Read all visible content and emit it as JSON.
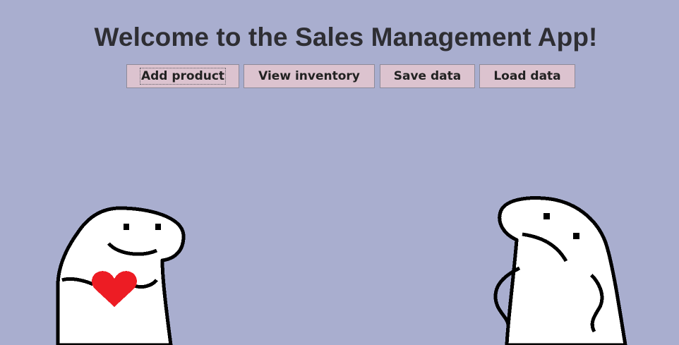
{
  "app": {
    "title": "Welcome to the Sales Management App!",
    "background": "#a9aecf"
  },
  "toolbar": {
    "buttons": [
      {
        "label": "Add product",
        "focused": true
      },
      {
        "label": "View inventory"
      },
      {
        "label": "Save data"
      },
      {
        "label": "Load data"
      }
    ],
    "button_color": "#dcc3cf"
  },
  "illustrations": {
    "left": {
      "icon": "flork-heart-character-icon",
      "accent": "#ed1c24"
    },
    "right": {
      "icon": "flork-sad-character-icon"
    }
  }
}
